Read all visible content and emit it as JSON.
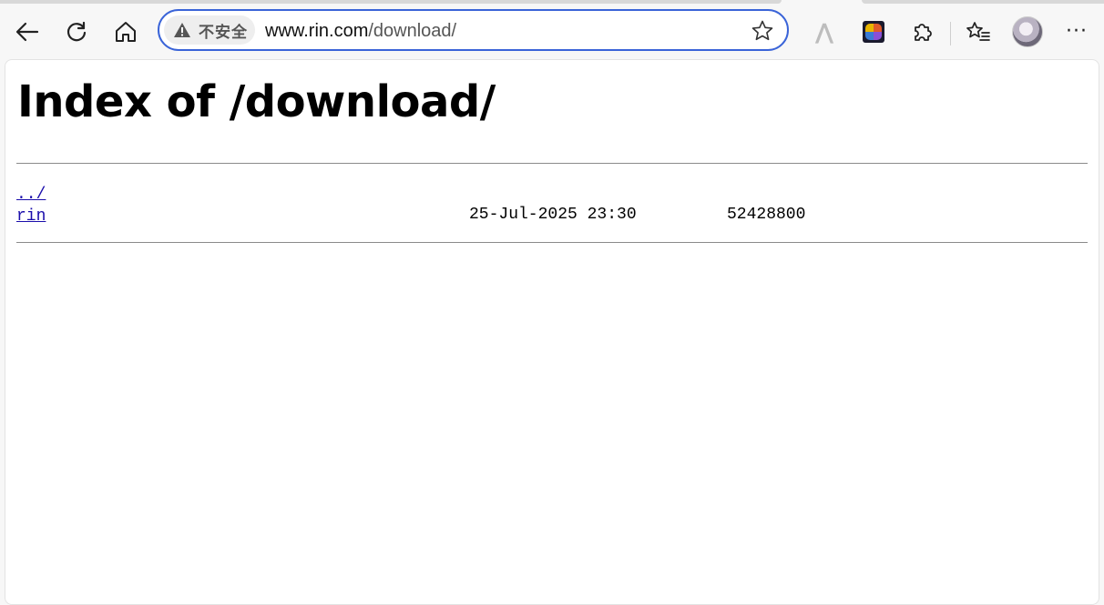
{
  "browser": {
    "security_label": "不安全",
    "url_host": "www.rin.com",
    "url_path": "/download/",
    "icons": {
      "back": "back-arrow-icon",
      "reload": "reload-icon",
      "home": "home-icon",
      "warning": "warning-triangle-icon",
      "favorite": "star-icon",
      "extension_a": "extension-a-icon",
      "extension_colored": "colored-extension-icon",
      "extensions": "puzzle-piece-icon",
      "favorites": "favorites-list-icon",
      "profile": "avatar",
      "more": "more-dots-icon"
    },
    "extension_a_glyph": "⋀",
    "more_glyph": "···",
    "accent_color": "#3a64d8"
  },
  "page": {
    "title": "Index of /download/",
    "entries": [
      {
        "name": "../",
        "date": "",
        "size": ""
      },
      {
        "name": "rin",
        "date": "25-Jul-2025 23:30",
        "size": "52428800"
      }
    ]
  }
}
